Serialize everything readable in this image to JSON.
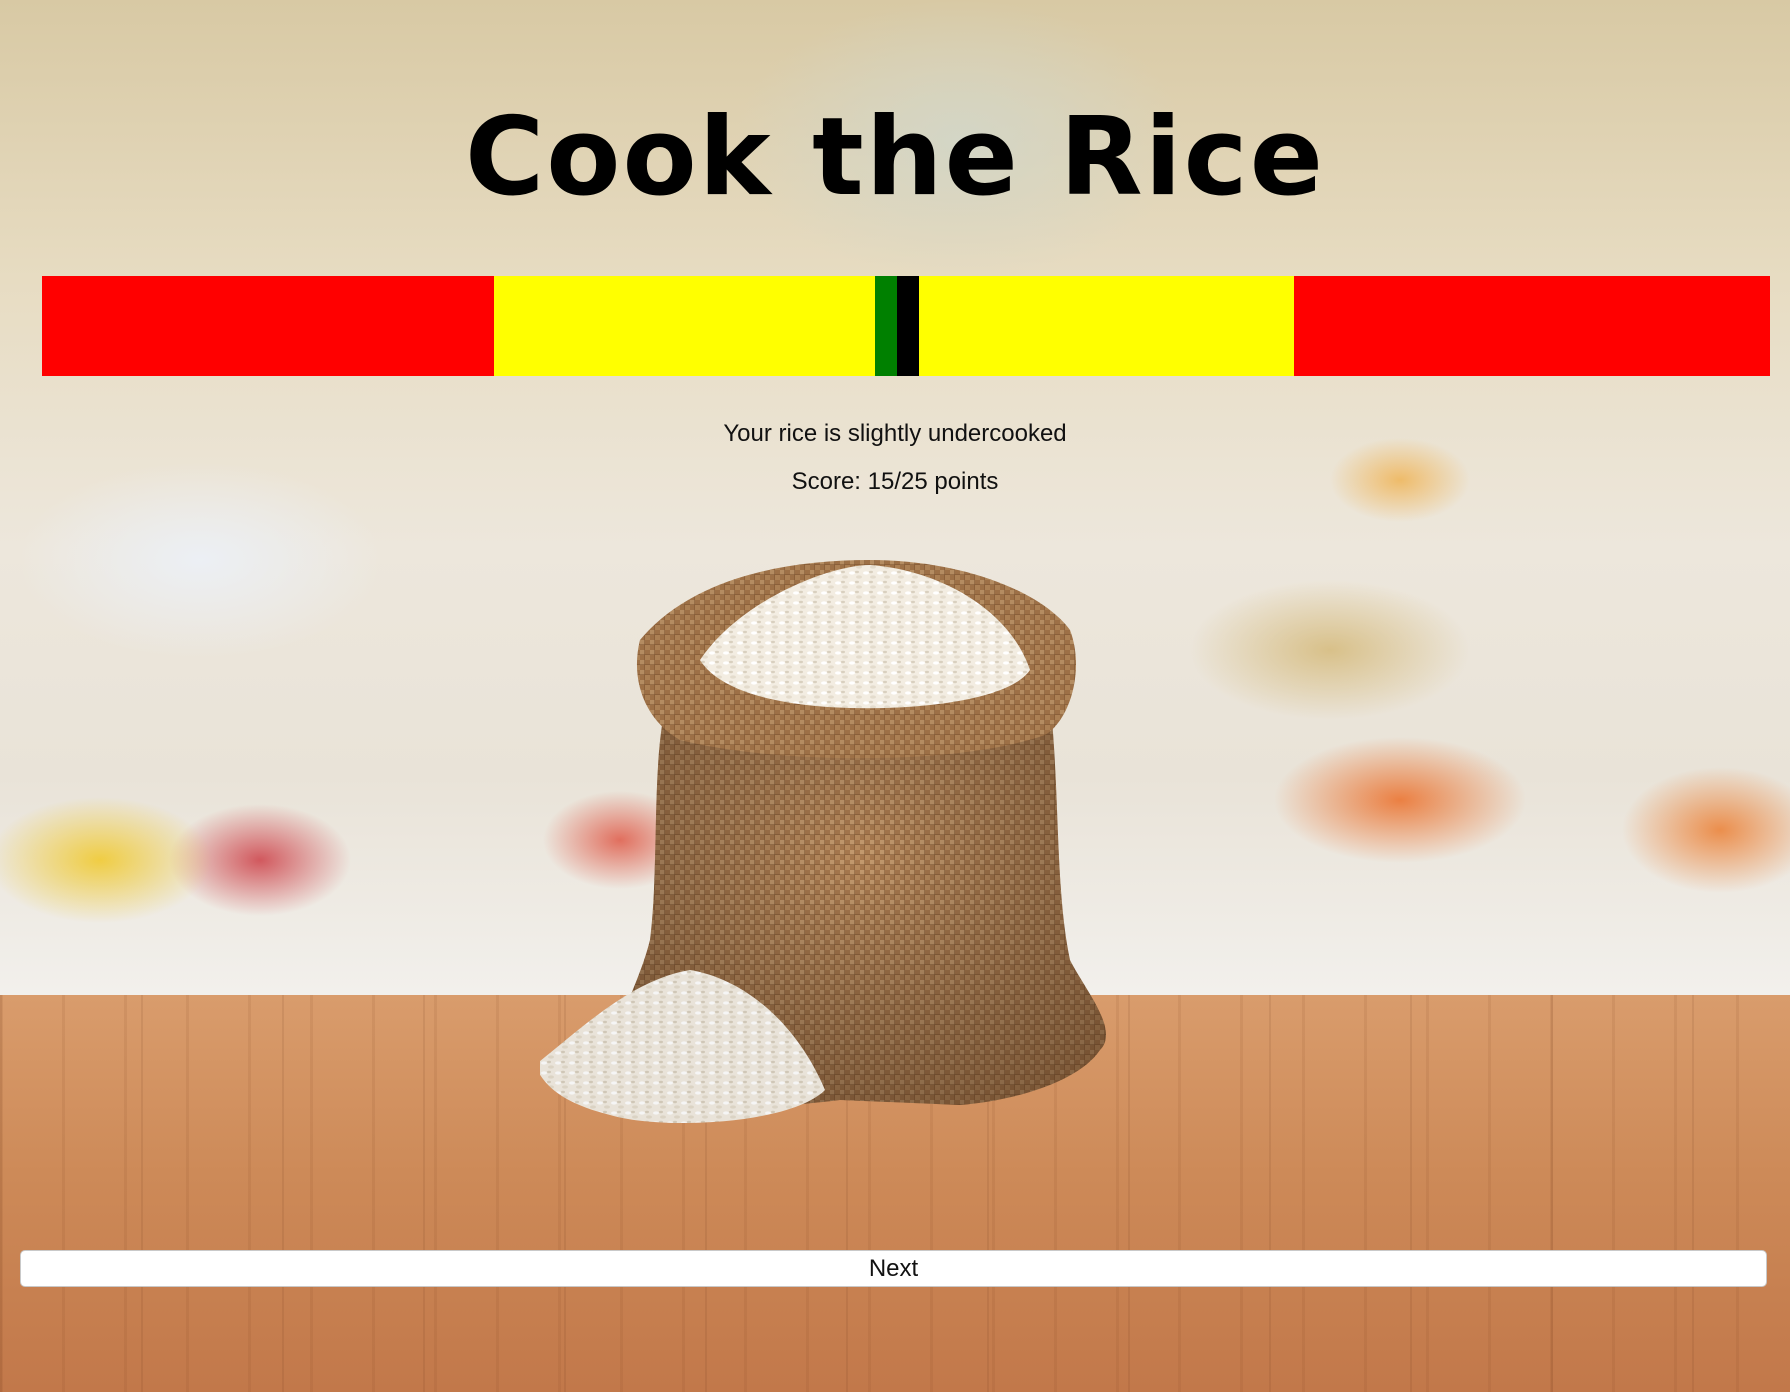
{
  "game": {
    "title": "Cook the Rice"
  },
  "meter": {
    "segments": [
      {
        "color": "#ff0000",
        "start": 0.0,
        "end": 0.2616
      },
      {
        "color": "#ffff00",
        "start": 0.2616,
        "end": 0.4822
      },
      {
        "color": "#008000",
        "start": 0.4822,
        "end": 0.4971
      },
      {
        "color": "#ffff00",
        "start": 0.4971,
        "end": 0.7245
      },
      {
        "color": "#ff0000",
        "start": 0.7245,
        "end": 1.0
      }
    ],
    "marker_position": 0.4947,
    "marker_color": "#000000"
  },
  "result": {
    "message": "Your rice is slightly undercooked",
    "score": "Score: 15/25 points"
  },
  "actions": {
    "next_label": "Next"
  },
  "scene": {
    "background": "blurred-kitchen",
    "tabletop": "wood",
    "centerpiece": "rice-sack-icon"
  }
}
